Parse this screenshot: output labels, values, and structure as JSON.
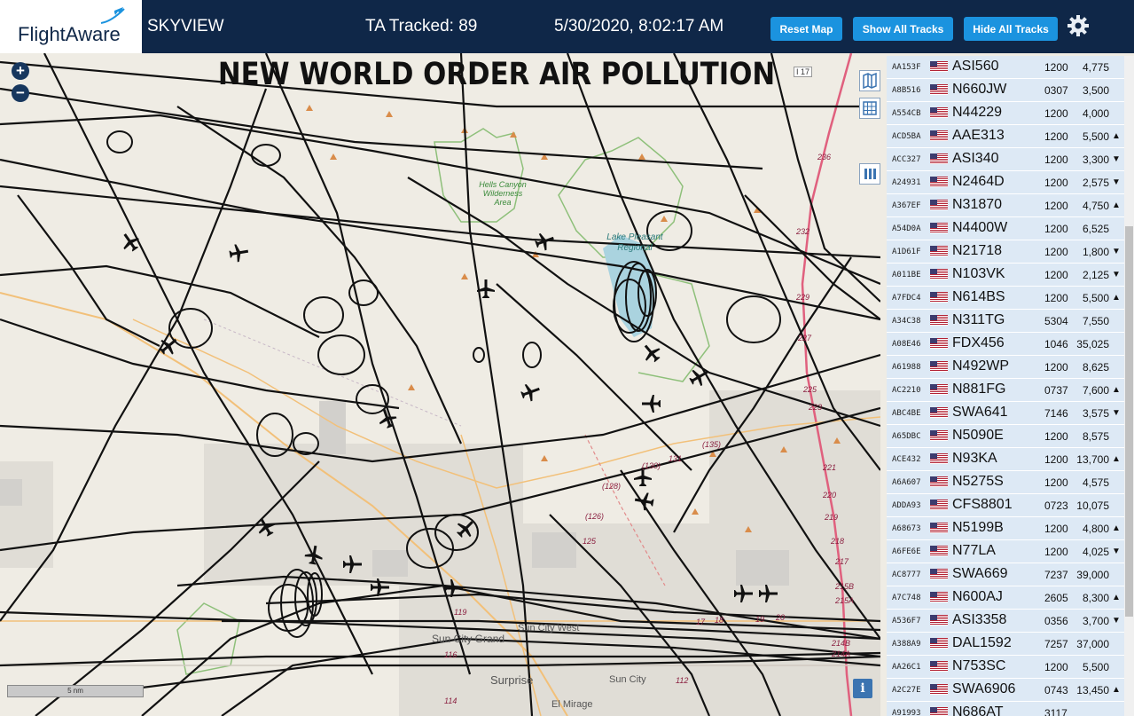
{
  "header": {
    "logo_text": "FlightAware",
    "app_title": "SKYVIEW",
    "tracked_label": "TA Tracked: 89",
    "datetime": "5/30/2020, 8:02:17 AM",
    "reset_label": "Reset Map",
    "show_label": "Show All Tracks",
    "hide_label": "Hide All Tracks",
    "gear_icon": "gear-icon"
  },
  "map": {
    "banner": "NEW WORLD ORDER AIR POLLUTION",
    "zoom_in": "+",
    "zoom_out": "−",
    "scale_label": "5 nm",
    "info_label": "i",
    "places": {
      "hells_canyon": "Hells Canyon Wilderness Area",
      "lake_pleasant": "Lake Pleasant Regional",
      "sun_city_grand": "Sun City Grand",
      "sun_city_west": "Sun City West",
      "surprise": "Surprise",
      "sun_city": "Sun City",
      "el_mirage": "El Mirage"
    },
    "road_labels": {
      "i17": "I 17",
      "r236": "236",
      "r232": "232",
      "r229": "229",
      "r227": "227",
      "r225": "225",
      "r223": "223",
      "r221": "221",
      "r220": "220",
      "r219": "219",
      "r218": "218",
      "r217": "217",
      "r215b": "215B",
      "r215a": "215A",
      "r214b": "214B",
      "r214a": "214A",
      "r135": "(135)",
      "r131": "131",
      "r130": "(130)",
      "r128": "(128)",
      "r126": "(126)",
      "r125": "125",
      "r119": "119",
      "r116": "116",
      "r114": "114",
      "r112": "112",
      "r17": "17",
      "r18": "18",
      "r19": "19",
      "r20": "20"
    },
    "colors": {
      "track": "#111111",
      "park_outline": "#8ec07a",
      "interstate": "#e0607e",
      "highway": "#f2c079"
    }
  },
  "aircraft_list": [
    {
      "hex": "AA153F",
      "ident": "ASI560",
      "squawk": "1200",
      "altitude": "4,775",
      "trend": ""
    },
    {
      "hex": "A8B516",
      "ident": "N660JW",
      "squawk": "0307",
      "altitude": "3,500",
      "trend": ""
    },
    {
      "hex": "A554CB",
      "ident": "N44229",
      "squawk": "1200",
      "altitude": "4,000",
      "trend": ""
    },
    {
      "hex": "ACD5BA",
      "ident": "AAE313",
      "squawk": "1200",
      "altitude": "5,500",
      "trend": "▲"
    },
    {
      "hex": "ACC327",
      "ident": "ASI340",
      "squawk": "1200",
      "altitude": "3,300",
      "trend": "▼"
    },
    {
      "hex": "A24931",
      "ident": "N2464D",
      "squawk": "1200",
      "altitude": "2,575",
      "trend": "▼"
    },
    {
      "hex": "A367EF",
      "ident": "N31870",
      "squawk": "1200",
      "altitude": "4,750",
      "trend": "▲"
    },
    {
      "hex": "A54D0A",
      "ident": "N4400W",
      "squawk": "1200",
      "altitude": "6,525",
      "trend": ""
    },
    {
      "hex": "A1D61F",
      "ident": "N21718",
      "squawk": "1200",
      "altitude": "1,800",
      "trend": "▼"
    },
    {
      "hex": "A011BE",
      "ident": "N103VK",
      "squawk": "1200",
      "altitude": "2,125",
      "trend": "▼"
    },
    {
      "hex": "A7FDC4",
      "ident": "N614BS",
      "squawk": "1200",
      "altitude": "5,500",
      "trend": "▲"
    },
    {
      "hex": "A34C38",
      "ident": "N311TG",
      "squawk": "5304",
      "altitude": "7,550",
      "trend": ""
    },
    {
      "hex": "A08E46",
      "ident": "FDX456",
      "squawk": "1046",
      "altitude": "35,025",
      "trend": ""
    },
    {
      "hex": "A61988",
      "ident": "N492WP",
      "squawk": "1200",
      "altitude": "8,625",
      "trend": ""
    },
    {
      "hex": "AC2210",
      "ident": "N881FG",
      "squawk": "0737",
      "altitude": "7,600",
      "trend": "▲"
    },
    {
      "hex": "ABC4BE",
      "ident": "SWA641",
      "squawk": "7146",
      "altitude": "3,575",
      "trend": "▼"
    },
    {
      "hex": "A65DBC",
      "ident": "N5090E",
      "squawk": "1200",
      "altitude": "8,575",
      "trend": ""
    },
    {
      "hex": "ACE432",
      "ident": "N93KA",
      "squawk": "1200",
      "altitude": "13,700",
      "trend": "▲"
    },
    {
      "hex": "A6A607",
      "ident": "N5275S",
      "squawk": "1200",
      "altitude": "4,575",
      "trend": ""
    },
    {
      "hex": "ADDA93",
      "ident": "CFS8801",
      "squawk": "0723",
      "altitude": "10,075",
      "trend": ""
    },
    {
      "hex": "A68673",
      "ident": "N5199B",
      "squawk": "1200",
      "altitude": "4,800",
      "trend": "▲"
    },
    {
      "hex": "A6FE6E",
      "ident": "N77LA",
      "squawk": "1200",
      "altitude": "4,025",
      "trend": "▼"
    },
    {
      "hex": "AC8777",
      "ident": "SWA669",
      "squawk": "7237",
      "altitude": "39,000",
      "trend": ""
    },
    {
      "hex": "A7C748",
      "ident": "N600AJ",
      "squawk": "2605",
      "altitude": "8,300",
      "trend": "▲"
    },
    {
      "hex": "A536F7",
      "ident": "ASI3358",
      "squawk": "0356",
      "altitude": "3,700",
      "trend": "▼"
    },
    {
      "hex": "A388A9",
      "ident": "DAL1592",
      "squawk": "7257",
      "altitude": "37,000",
      "trend": ""
    },
    {
      "hex": "AA26C1",
      "ident": "N753SC",
      "squawk": "1200",
      "altitude": "5,500",
      "trend": ""
    },
    {
      "hex": "A2C27E",
      "ident": "SWA6906",
      "squawk": "0743",
      "altitude": "13,450",
      "trend": "▲"
    },
    {
      "hex": "A91993",
      "ident": "N686AT",
      "squawk": "3117",
      "altitude": "",
      "trend": ""
    }
  ]
}
